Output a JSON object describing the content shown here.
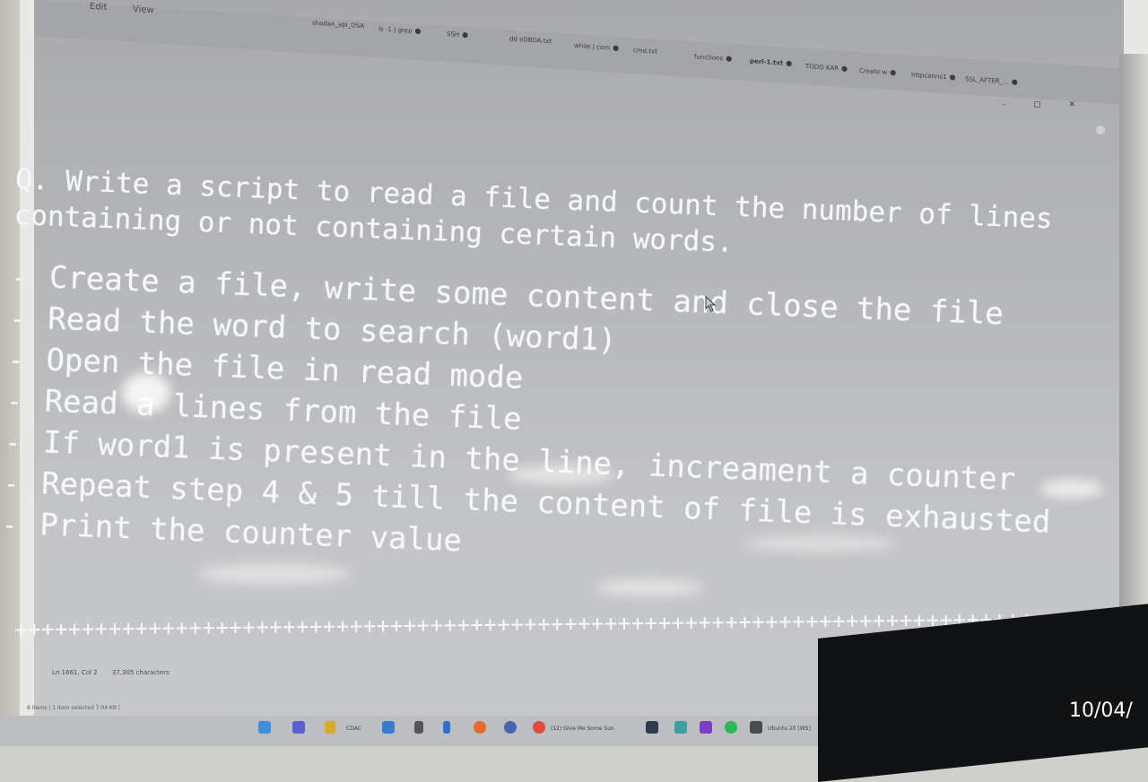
{
  "menu": {
    "file": "Edit",
    "view": "View"
  },
  "tabs": [
    {
      "label": "shodan_api_OSA",
      "active": false
    },
    {
      "label": "ls -1 | grep",
      "active": false
    },
    {
      "label": "SSH",
      "active": false
    },
    {
      "label": "dd eDBDA.txt",
      "active": false
    },
    {
      "label": "while | com",
      "active": false
    },
    {
      "label": "cmd.txt",
      "active": false
    },
    {
      "label": "functions",
      "active": false
    },
    {
      "label": "perl-1.txt",
      "active": true
    },
    {
      "label": "TODO KAR",
      "active": false
    },
    {
      "label": "Create w",
      "active": false
    },
    {
      "label": "httpconns1",
      "active": false
    },
    {
      "label": "SSL_AFTER_...",
      "active": false
    }
  ],
  "window_controls": "- ▢ ✕",
  "editor": {
    "question_line1": "Q. Write a script to read a file and count the number of lines",
    "question_line2": "containing or not containing certain words.",
    "steps": [
      "Create a file, write some content and close the file",
      "Read the word to search (word1)",
      "Open the file in read mode",
      "Read a lines from the file",
      "If word1 is present in the line, increament a counter",
      "Repeat step 4 & 5 till the content of file is exhausted",
      "Print the counter value"
    ],
    "separator": "+++++++++++++++++++++++++++++++++++++++++++++++++++++++++++++++++++++++++++++"
  },
  "status": {
    "position": "Ln 1661, Col 2",
    "characters": "37,305 characters"
  },
  "explorer_status": "8 items | 1 item selected 7.04 KB |",
  "taskbar": {
    "cdac_label": "CDAC",
    "browser_label": "(12) Give Me Some Sun",
    "ubuntu_label": "Ubuntu 20 [WS]"
  },
  "timestamp": "10/04/"
}
